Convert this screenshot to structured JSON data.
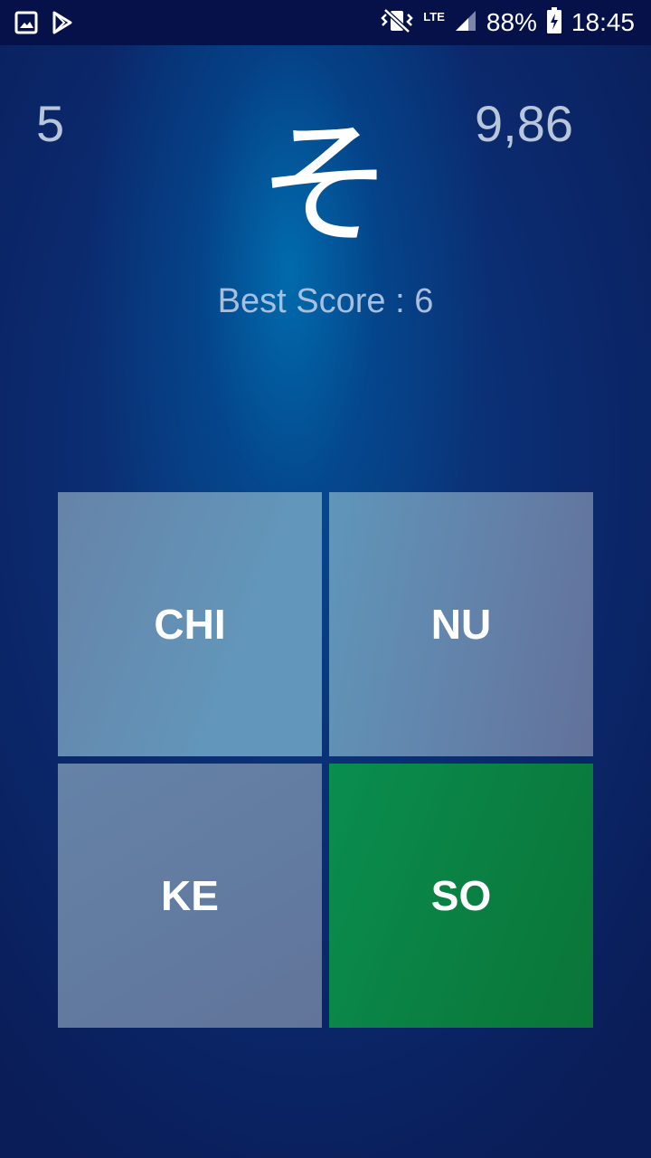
{
  "status_bar": {
    "battery": "88%",
    "time": "18:45",
    "network": "LTE",
    "icons": [
      "gallery-icon",
      "play-store-icon",
      "vibrate-mute-icon",
      "lte-data-icon",
      "signal-icon",
      "battery-charging-icon"
    ]
  },
  "game": {
    "score": "5",
    "timer": "9,86",
    "kana": "そ",
    "best_score": "Best Score : 6"
  },
  "answers": [
    {
      "label": "CHI",
      "state": "neutral",
      "color": "#6290b5"
    },
    {
      "label": "NU",
      "state": "neutral",
      "color": "#6288b0"
    },
    {
      "label": "KE",
      "state": "neutral",
      "color": "#627ba1"
    },
    {
      "label": "SO",
      "state": "correct",
      "color": "#0a8045"
    }
  ],
  "colors": {
    "status_bar": "#06114a",
    "background_dark": "#0a1d58",
    "background_glow": "#0065a8",
    "text_muted": "#b8c6dc",
    "correct": "#0a8045"
  }
}
